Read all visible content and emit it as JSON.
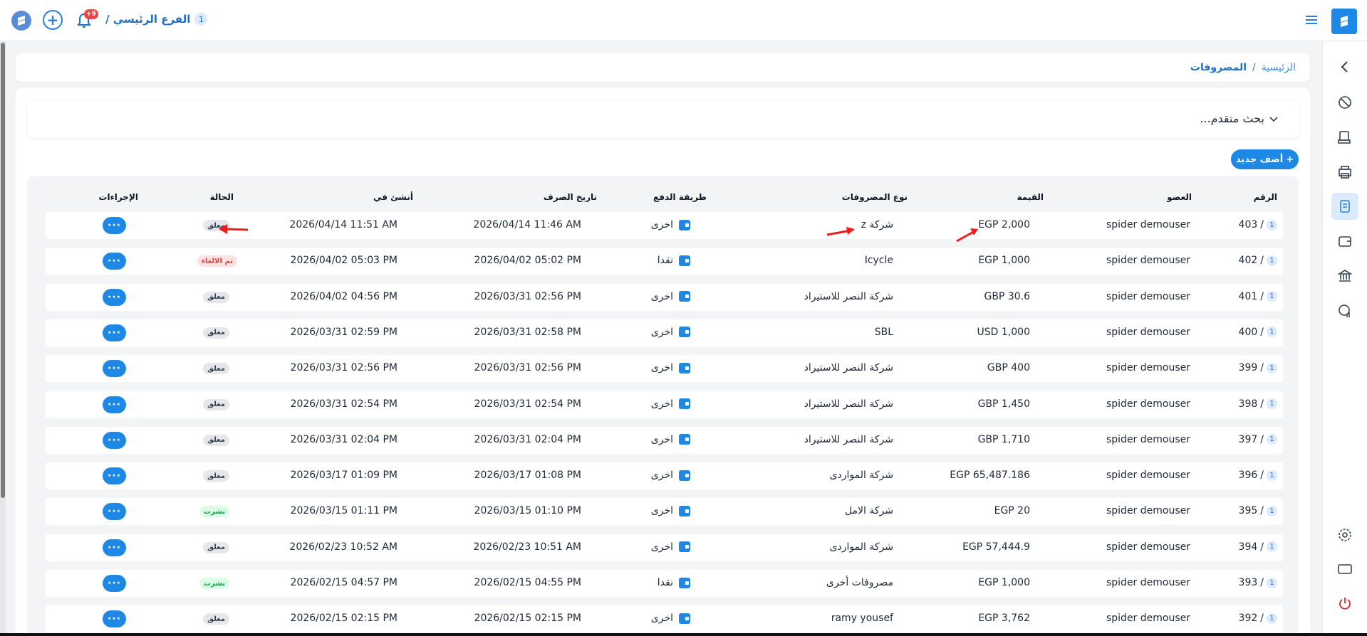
{
  "topbar": {
    "branch_num": "1",
    "branch_name": "الفرع الرئيسي /",
    "notifications_badge": "+9"
  },
  "breadcrumb": {
    "home": "الرئيسية",
    "separator": "/",
    "current": "المصروفات"
  },
  "search": {
    "label": "بحث متقدم..."
  },
  "add_button": {
    "label": "أضف جديد",
    "icon": "+"
  },
  "table": {
    "headers": {
      "number": "الرقم",
      "member": "العضو",
      "amount": "القيمة",
      "type": "نوع المصروفات",
      "method": "طريقة الدفع",
      "spent_date": "تاريخ الصرف",
      "created_at": "أنشئ في",
      "status": "الحالة",
      "actions": "الإجراءات"
    },
    "rows": [
      {
        "num": "403",
        "branch": "1",
        "member": "spider demouser",
        "amount": "EGP 2,000",
        "type": "شركة z",
        "method": "اخرى",
        "spent": "2026/04/14 11:46 AM",
        "created": "2026/04/14 11:51 AM",
        "status": "معلق",
        "status_kind": "pending",
        "action": "···"
      },
      {
        "num": "402",
        "branch": "1",
        "member": "spider demouser",
        "amount": "EGP 1,000",
        "type": "Icycle",
        "method": "نقدا",
        "spent": "2026/04/02 05:02 PM",
        "created": "2026/04/02 05:03 PM",
        "status": "تم الالغاء",
        "status_kind": "cancel",
        "action": "···"
      },
      {
        "num": "401",
        "branch": "1",
        "member": "spider demouser",
        "amount": "GBP 30.6",
        "type": "شركة النصر للاستيراد",
        "method": "اخرى",
        "spent": "2026/03/31 02:56 PM",
        "created": "2026/04/02 04:56 PM",
        "status": "معلق",
        "status_kind": "pending",
        "action": "···"
      },
      {
        "num": "400",
        "branch": "1",
        "member": "spider demouser",
        "amount": "USD 1,000",
        "type": "SBL",
        "method": "اخرى",
        "spent": "2026/03/31 02:58 PM",
        "created": "2026/03/31 02:59 PM",
        "status": "معلق",
        "status_kind": "pending",
        "action": "···"
      },
      {
        "num": "399",
        "branch": "1",
        "member": "spider demouser",
        "amount": "GBP 400",
        "type": "شركة النصر للاستيراد",
        "method": "اخرى",
        "spent": "2026/03/31 02:56 PM",
        "created": "2026/03/31 02:56 PM",
        "status": "معلق",
        "status_kind": "pending",
        "action": "···"
      },
      {
        "num": "398",
        "branch": "1",
        "member": "spider demouser",
        "amount": "GBP 1,450",
        "type": "شركة النصر للاستيراد",
        "method": "اخرى",
        "spent": "2026/03/31 02:54 PM",
        "created": "2026/03/31 02:54 PM",
        "status": "معلق",
        "status_kind": "pending",
        "action": "···"
      },
      {
        "num": "397",
        "branch": "1",
        "member": "spider demouser",
        "amount": "GBP 1,710",
        "type": "شركة النصر للاستيراد",
        "method": "اخرى",
        "spent": "2026/03/31 02:04 PM",
        "created": "2026/03/31 02:04 PM",
        "status": "معلق",
        "status_kind": "pending",
        "action": "···"
      },
      {
        "num": "396",
        "branch": "1",
        "member": "spider demouser",
        "amount": "EGP 65,487.186",
        "type": "شركة الموارد‏ى",
        "method": "اخرى",
        "spent": "2026/03/17 01:08 PM",
        "created": "2026/03/17 01:09 PM",
        "status": "معلق",
        "status_kind": "pending",
        "action": "···"
      },
      {
        "num": "395",
        "branch": "1",
        "member": "spider demouser",
        "amount": "EGP 20",
        "type": "شركة الامل",
        "method": "اخرى",
        "spent": "2026/03/15 01:10 PM",
        "created": "2026/03/15 01:11 PM",
        "status": "نشرت",
        "status_kind": "published",
        "action": "···"
      },
      {
        "num": "394",
        "branch": "1",
        "member": "spider demouser",
        "amount": "EGP 57,444.9",
        "type": "شركة الموارد‏ى",
        "method": "اخرى",
        "spent": "2026/02/23 10:51 AM",
        "created": "2026/02/23 10:52 AM",
        "status": "معلق",
        "status_kind": "pending",
        "action": "···"
      },
      {
        "num": "393",
        "branch": "1",
        "member": "spider demouser",
        "amount": "EGP 1,000",
        "type": "مصروفات أخرى",
        "method": "نقدا",
        "spent": "2026/02/15 04:55 PM",
        "created": "2026/02/15 04:57 PM",
        "status": "نشرت",
        "status_kind": "published",
        "action": "···"
      },
      {
        "num": "392",
        "branch": "1",
        "member": "spider demouser",
        "amount": "EGP 3,762",
        "type": "ramy yousef",
        "method": "اخرى",
        "spent": "2026/02/15 02:15 PM",
        "created": "2026/02/15 02:15 PM",
        "status": "معلق",
        "status_kind": "pending",
        "action": "···"
      }
    ]
  },
  "colors": {
    "accent": "#1e88e5",
    "annotation_arrow": "#ef1c1c"
  },
  "sidebar_icons": [
    "chevron-left-icon",
    "dashboard-icon",
    "pos-icon",
    "printer-icon",
    "expenses-icon",
    "wallet-icon",
    "bank-icon",
    "reports-icon",
    "settings-icon",
    "monitor-icon",
    "power-icon"
  ]
}
